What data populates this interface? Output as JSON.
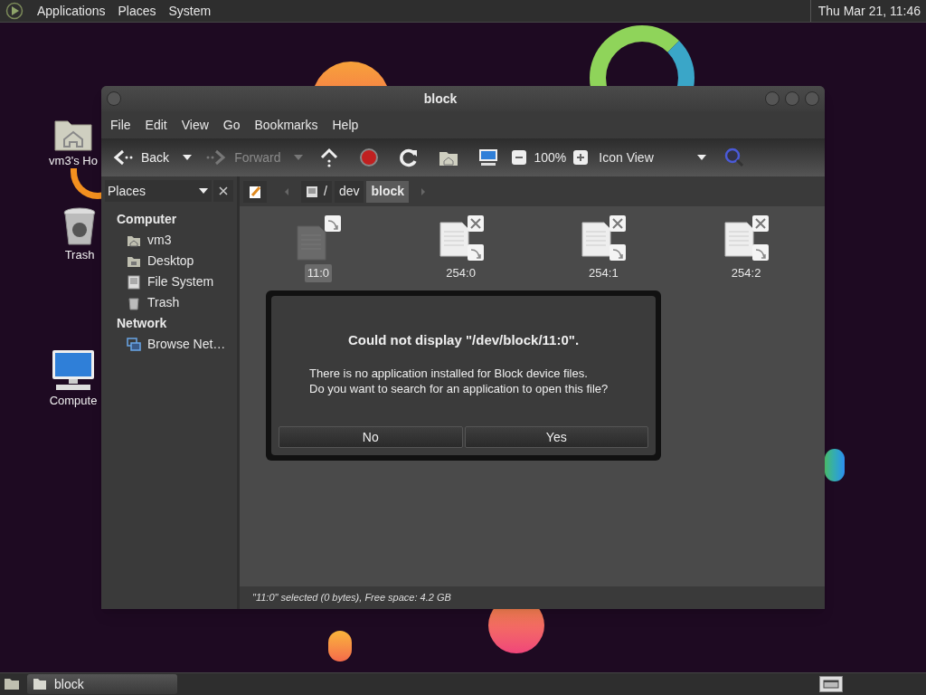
{
  "top_panel": {
    "menus": [
      "Applications",
      "Places",
      "System"
    ],
    "clock": "Thu Mar 21, 11:46"
  },
  "desktop_icons": [
    {
      "label": "vm3's Ho",
      "kind": "home"
    },
    {
      "label": "Trash",
      "kind": "trash"
    },
    {
      "label": "Compute",
      "kind": "computer"
    }
  ],
  "window": {
    "title": "block",
    "menu": [
      "File",
      "Edit",
      "View",
      "Go",
      "Bookmarks",
      "Help"
    ],
    "toolbar": {
      "back": {
        "label": "Back",
        "disabled": false
      },
      "forward": {
        "label": "Forward",
        "disabled": true
      },
      "zoom": "100%",
      "view": "Icon View"
    },
    "sidebar": {
      "selector": "Places",
      "sections": [
        {
          "heading": "Computer",
          "items": [
            {
              "label": "vm3",
              "kind": "home"
            },
            {
              "label": "Desktop",
              "kind": "desktop"
            },
            {
              "label": "File System",
              "kind": "drive"
            },
            {
              "label": "Trash",
              "kind": "trash"
            }
          ]
        },
        {
          "heading": "Network",
          "items": [
            {
              "label": "Browse Net…",
              "kind": "network"
            }
          ]
        }
      ]
    },
    "path": [
      {
        "label": "/",
        "selected": false
      },
      {
        "label": "dev",
        "selected": false
      },
      {
        "label": "block",
        "selected": true
      }
    ],
    "files": [
      {
        "name": "11:0",
        "kind": "link",
        "selected": true
      },
      {
        "name": "254:0",
        "kind": "broken-link",
        "selected": false
      },
      {
        "name": "254:1",
        "kind": "broken-link",
        "selected": false
      },
      {
        "name": "254:2",
        "kind": "broken-link",
        "selected": false
      }
    ],
    "status": "\"11:0\" selected (0 bytes), Free space: 4.2 GB"
  },
  "dialog": {
    "title": "Could not display \"/dev/block/11:0\".",
    "message": "There is no application installed for Block device files.\nDo you want to search for an application to open this file?",
    "buttons": [
      "No",
      "Yes"
    ]
  },
  "taskbar": {
    "tasks": [
      {
        "label": "block"
      }
    ]
  }
}
